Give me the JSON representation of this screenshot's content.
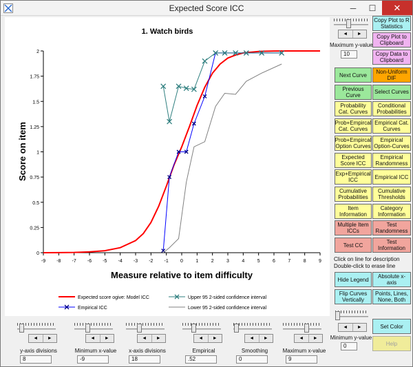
{
  "window": {
    "title": "Expected Score ICC"
  },
  "titlebar": {
    "minimize_label": "─",
    "maximize_label": "☐",
    "close_label": "✕"
  },
  "chart_data": {
    "type": "line",
    "title": "1. Watch birds",
    "xlabel": "Measure relative to item difficulty",
    "ylabel": "Score on item",
    "xlim": [
      -9,
      9
    ],
    "ylim": [
      0,
      2
    ],
    "x_ticks": [
      "-9",
      "-8",
      "-7",
      "-6",
      "-5",
      "-4",
      "-3",
      "-2",
      "-1",
      "0",
      "1",
      "2",
      "3",
      "4",
      "5",
      "6",
      "7",
      "8",
      "9"
    ],
    "y_ticks": [
      "0",
      "0.25",
      "0.5",
      "0.75",
      "1",
      "1.25",
      "1.5",
      "1.75",
      "2"
    ],
    "legend_position": "bottom",
    "series": [
      {
        "name": "Expected score ogive: Model ICC",
        "color": "#ff0000",
        "x": [
          -9,
          -8,
          -7,
          -6,
          -5,
          -4,
          -3,
          -2.5,
          -2,
          -1.5,
          -1,
          -0.5,
          0,
          0.5,
          1,
          1.5,
          2,
          2.5,
          3,
          3.5,
          4,
          5,
          6,
          7,
          8,
          9
        ],
        "y": [
          0,
          0.001,
          0.003,
          0.008,
          0.02,
          0.05,
          0.12,
          0.19,
          0.3,
          0.46,
          0.66,
          0.87,
          1.05,
          1.25,
          1.46,
          1.64,
          1.78,
          1.87,
          1.93,
          1.96,
          1.98,
          1.995,
          1.999,
          2,
          2,
          2
        ]
      },
      {
        "name": "Empirical ICC",
        "color": "#0000ff",
        "marker": "x",
        "x": [
          -1.2,
          -0.8,
          -0.2,
          0.3,
          0.8,
          1.5,
          2.2,
          2.8,
          3.5,
          4.2,
          5.2,
          6.5
        ],
        "y": [
          0.02,
          0.75,
          1,
          1,
          1.28,
          1.55,
          1.98,
          1.98,
          1.98,
          1.98,
          1.98,
          1.98
        ]
      },
      {
        "name": "Upper 95 2-sided confidence interval",
        "color": "#2f7f7f",
        "marker": "x",
        "x": [
          -1.2,
          -0.8,
          -0.2,
          0.3,
          0.8,
          1.5,
          2.2,
          2.8,
          3.5,
          4.2,
          5.2,
          6.5
        ],
        "y": [
          1.65,
          1.3,
          1.65,
          1.63,
          1.62,
          1.9,
          1.98,
          1.98,
          1.98,
          1.98,
          1.98,
          1.98
        ]
      },
      {
        "name": "Lower 95 2-sided confidence interval",
        "color": "#808080",
        "x": [
          -1.2,
          -0.8,
          -0.2,
          0.3,
          0.8,
          1.5,
          2.2,
          2.8,
          3.5,
          4.2,
          5.2,
          6.5
        ],
        "y": [
          0,
          0.05,
          0.14,
          0.7,
          1.05,
          1.1,
          1.45,
          1.58,
          1.57,
          1.7,
          1.78,
          1.87
        ]
      }
    ]
  },
  "right_panel": {
    "max_y_label": "Maximum y-value",
    "max_y_value": "10",
    "min_y_label": "Minimum y-value",
    "min_y_value": "0",
    "note_line1": "Click on line for description",
    "note_line2": "Double-click to erase line",
    "buttons": [
      {
        "id": "copy-plot-r",
        "label": "Copy Plot to R Statistics",
        "color": "cyan"
      },
      {
        "id": "copy-plot-clipboard",
        "label": "Copy Plot to Clipboard",
        "color": "pink"
      },
      {
        "id": "copy-data-clipboard",
        "label": "Copy Data to Clipboard",
        "color": "pink"
      },
      {
        "id": "next-curve",
        "label": "Next Curve",
        "color": "green"
      },
      {
        "id": "non-uniform-dif",
        "label": "Non-Uniform DIF",
        "color": "orange"
      },
      {
        "id": "previous-curve",
        "label": "Previous Curve",
        "color": "green"
      },
      {
        "id": "select-curves",
        "label": "Select Curves",
        "color": "green"
      },
      {
        "id": "probability-cat-curves",
        "label": "Probability Cat. Curves",
        "color": "yellow"
      },
      {
        "id": "conditional-probabilities",
        "label": "Conditional Probabilities",
        "color": "yellow"
      },
      {
        "id": "prob-empirical-cat-curves",
        "label": "Prob+Empircal Cat. Curves",
        "color": "yellow"
      },
      {
        "id": "empirical-cat-curves",
        "label": "Empirical Cat. Curves",
        "color": "yellow"
      },
      {
        "id": "prob-empirical-option-curves",
        "label": "Prob+Empircal Option Curves",
        "color": "yellow"
      },
      {
        "id": "empirical-option-curves",
        "label": "Empirical Option-Curves",
        "color": "yellow"
      },
      {
        "id": "expected-score-icc",
        "label": "Expected Score ICC",
        "color": "yellow"
      },
      {
        "id": "empirical-randomness",
        "label": "Empirical Randomness",
        "color": "yellow"
      },
      {
        "id": "exp-empirical-icc",
        "label": "Exp+Empirical ICC",
        "color": "yellow"
      },
      {
        "id": "empirical-icc",
        "label": "Empirical ICC",
        "color": "yellow"
      },
      {
        "id": "cumulative-probabilities",
        "label": "Cumulative Probabilities",
        "color": "yellow"
      },
      {
        "id": "cumulative-thresholds",
        "label": "Cumulative Thresholds",
        "color": "yellow"
      },
      {
        "id": "item-information",
        "label": "Item Information",
        "color": "yellow"
      },
      {
        "id": "category-information",
        "label": "Category Information",
        "color": "yellow"
      },
      {
        "id": "multiple-item-iccs",
        "label": "Multiple Item ICCs",
        "color": "red"
      },
      {
        "id": "test-randomness",
        "label": "Test Randomness",
        "color": "red"
      },
      {
        "id": "test-cc",
        "label": "Test CC",
        "color": "red"
      },
      {
        "id": "test-information",
        "label": "Test Information",
        "color": "red"
      },
      {
        "id": "hide-legend",
        "label": "Hide Legend",
        "color": "cyan"
      },
      {
        "id": "absolute-x-axis",
        "label": "Absolute x-axis",
        "color": "cyan"
      },
      {
        "id": "flip-curves-vertically",
        "label": "Flip Curves Vertically",
        "color": "cyan"
      },
      {
        "id": "points-lines-none-both",
        "label": "Points, Lines, None, Both",
        "color": "cyan"
      },
      {
        "id": "set-color",
        "label": "Set Color",
        "color": "cyan"
      },
      {
        "id": "help",
        "label": "Help",
        "color": "disabled"
      }
    ]
  },
  "bottom_controls": [
    {
      "id": "y-axis-divisions",
      "label": "y-axis divisions",
      "value": "8"
    },
    {
      "id": "minimum-x-value",
      "label": "Minimum x-value",
      "value": "-9"
    },
    {
      "id": "x-axis-divisions",
      "label": "x-axis divisions",
      "value": "18"
    },
    {
      "id": "empirical",
      "label": "Empirical",
      "value": ".52"
    },
    {
      "id": "smoothing",
      "label": "Smoothing",
      "value": "0"
    },
    {
      "id": "maximum-x-value",
      "label": "Maximum x-value",
      "value": "9"
    }
  ],
  "spin_left": "◄",
  "spin_right": "►"
}
